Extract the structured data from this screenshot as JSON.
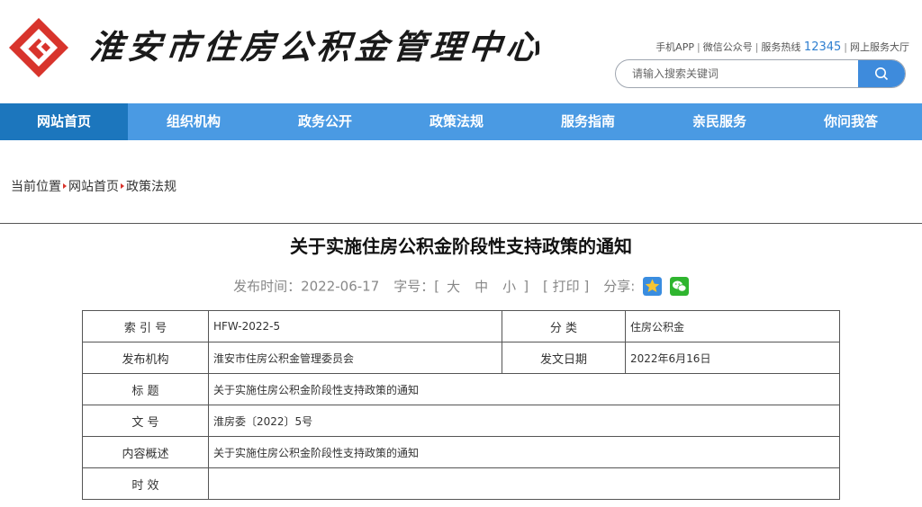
{
  "header": {
    "site_title": "淮安市住房公积金管理中心",
    "links": {
      "app": "手机APP",
      "wechat": "微信公众号",
      "hotline_label": "服务热线",
      "hotline_number": "12345",
      "online_hall": "网上服务大厅"
    },
    "search": {
      "placeholder": "请输入搜索关键词"
    },
    "colors": {
      "logo_red": "#d8342c",
      "nav_blue": "#4a9ae3",
      "nav_active": "#1c76bd",
      "search_button": "#3e8bdc"
    }
  },
  "nav": {
    "items": [
      {
        "label": "网站首页",
        "active": true
      },
      {
        "label": "组织机构"
      },
      {
        "label": "政务公开"
      },
      {
        "label": "政策法规"
      },
      {
        "label": "服务指南"
      },
      {
        "label": "亲民服务"
      },
      {
        "label": "你问我答"
      }
    ]
  },
  "breadcrumb": {
    "prefix": "当前位置",
    "items": [
      "网站首页",
      "政策法规"
    ]
  },
  "article": {
    "title": "关于实施住房公积金阶段性支持政策的通知",
    "meta": {
      "publish_label": "发布时间：",
      "publish_date": "2022-06-17",
      "fontsize_label": "字号：[",
      "size_large": "大",
      "size_medium": "中",
      "size_small": "小",
      "fontsize_close": "]",
      "print": "[ 打印 ]",
      "share_label": "分享:"
    },
    "info": {
      "index_label": "索 引 号",
      "index_value": "HFW-2022-5",
      "category_label": "分 类",
      "category_value": "住房公积金",
      "issuer_label": "发布机构",
      "issuer_value": "淮安市住房公积金管理委员会",
      "date_label": "发文日期",
      "date_value": "2022年6月16日",
      "title_label": "标 题",
      "title_value": "关于实施住房公积金阶段性支持政策的通知",
      "docno_label": "文 号",
      "docno_value": "淮房委〔2022〕5号",
      "summary_label": "内容概述",
      "summary_value": "关于实施住房公积金阶段性支持政策的通知",
      "validity_label": "时 效",
      "validity_value": ""
    }
  }
}
